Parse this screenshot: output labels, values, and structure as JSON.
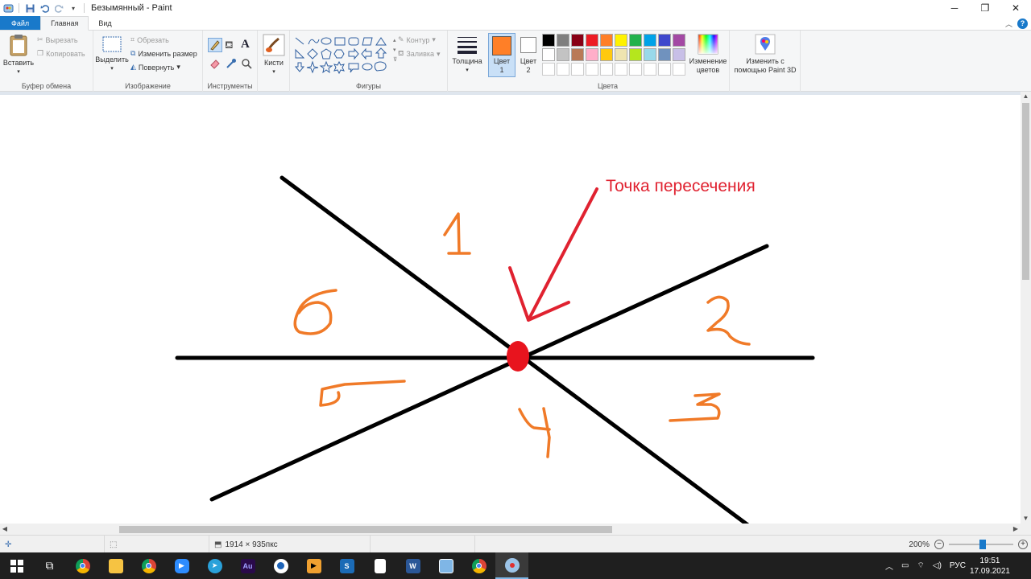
{
  "window": {
    "title": "Безымянный - Paint",
    "controls": {
      "minimize": "─",
      "maximize": "❐",
      "close": "✕"
    }
  },
  "tabs": [
    {
      "label": "Файл"
    },
    {
      "label": "Главная"
    },
    {
      "label": "Вид"
    }
  ],
  "ribbon": {
    "clipboard": {
      "group": "Буфер обмена",
      "paste": "Вставить",
      "cut": "Вырезать",
      "copy": "Копировать"
    },
    "image": {
      "group": "Изображение",
      "select": "Выделить",
      "crop": "Обрезать",
      "resize": "Изменить размер",
      "rotate": "Повернуть"
    },
    "tools": {
      "group": "Инструменты"
    },
    "brushes": {
      "label": "Кисти"
    },
    "shapes": {
      "group": "Фигуры",
      "outline": "Контур",
      "fill": "Заливка"
    },
    "size": {
      "label": "Толщина"
    },
    "colors": {
      "group": "Цвета",
      "color1": "Цвет 1",
      "color2": "Цвет 2",
      "color1_value": "#ff7f27",
      "color2_value": "#ffffff",
      "edit": "Изменение цветов",
      "paint3d": "Изменить с помощью Paint 3D",
      "row1": [
        "#000000",
        "#7f7f7f",
        "#880015",
        "#ed1c24",
        "#ff7f27",
        "#fff200",
        "#22b14c",
        "#00a2e8",
        "#3f48cc",
        "#a349a4"
      ],
      "row2": [
        "#ffffff",
        "#c3c3c3",
        "#b97a57",
        "#ffaec9",
        "#ffc90e",
        "#efe4b0",
        "#b5e61d",
        "#99d9ea",
        "#7092be",
        "#c8bfe7"
      ]
    }
  },
  "canvas": {
    "annotation": "Точка пересечения",
    "regions": [
      "1",
      "2",
      "3",
      "4",
      "5",
      "6"
    ]
  },
  "statusbar": {
    "dimensions": "1914 × 935пкс",
    "zoom": "200%"
  },
  "taskbar": {
    "lang": "РУС",
    "time": "19:51",
    "date": "17.09.2021"
  }
}
